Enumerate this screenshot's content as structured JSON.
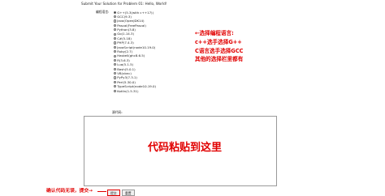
{
  "page": {
    "title": "Submit Your Solution for Problem 01: Hello, World!",
    "language_label": "编程语言:",
    "code_label": "源代码:"
  },
  "languages": [
    {
      "label": "G++(5.3(with c++17))",
      "selected": true
    },
    {
      "label": "GCC(9.3)",
      "selected": false
    },
    {
      "label": "Java(OpenJDK14)",
      "selected": false
    },
    {
      "label": "Pascal(FreePascal)",
      "selected": false
    },
    {
      "label": "Python(3.8)",
      "selected": false
    },
    {
      "label": "Go(1.14.3)",
      "selected": false
    },
    {
      "label": "C#(5.18)",
      "selected": false
    },
    {
      "label": "PHP(7.4.3)",
      "selected": false
    },
    {
      "label": "JavaScript(node10.19.0)",
      "selected": false
    },
    {
      "label": "Ruby(2.7)",
      "selected": false
    },
    {
      "label": "Haskell(ghc8.6.5)",
      "selected": false
    },
    {
      "label": "R(3.6.3)",
      "selected": false
    },
    {
      "label": "Lua(5.1.5)",
      "selected": false
    },
    {
      "label": "Bash(5.0.1)",
      "selected": false
    },
    {
      "label": "VB(vbnc)",
      "selected": false
    },
    {
      "label": "PyPy3(7.3.1)",
      "selected": false
    },
    {
      "label": "Perl(5.30.0)",
      "selected": false
    },
    {
      "label": "TypeScript(node10.19.0)",
      "selected": false
    },
    {
      "label": "Kotlin(1.5.31)",
      "selected": false
    }
  ],
  "buttons": {
    "submit": "提交",
    "reset": "重置"
  },
  "annotations": {
    "lines": [
      "←选择编程语言:",
      "c++选手选择G++",
      "C语言选手选择GCC",
      "其他的选择栏里都有"
    ],
    "code": "代码粘贴到这里",
    "submit": "确认代码无误，提交→"
  },
  "colors": {
    "annotation": "#e10000",
    "border": "#9a9a9a"
  }
}
